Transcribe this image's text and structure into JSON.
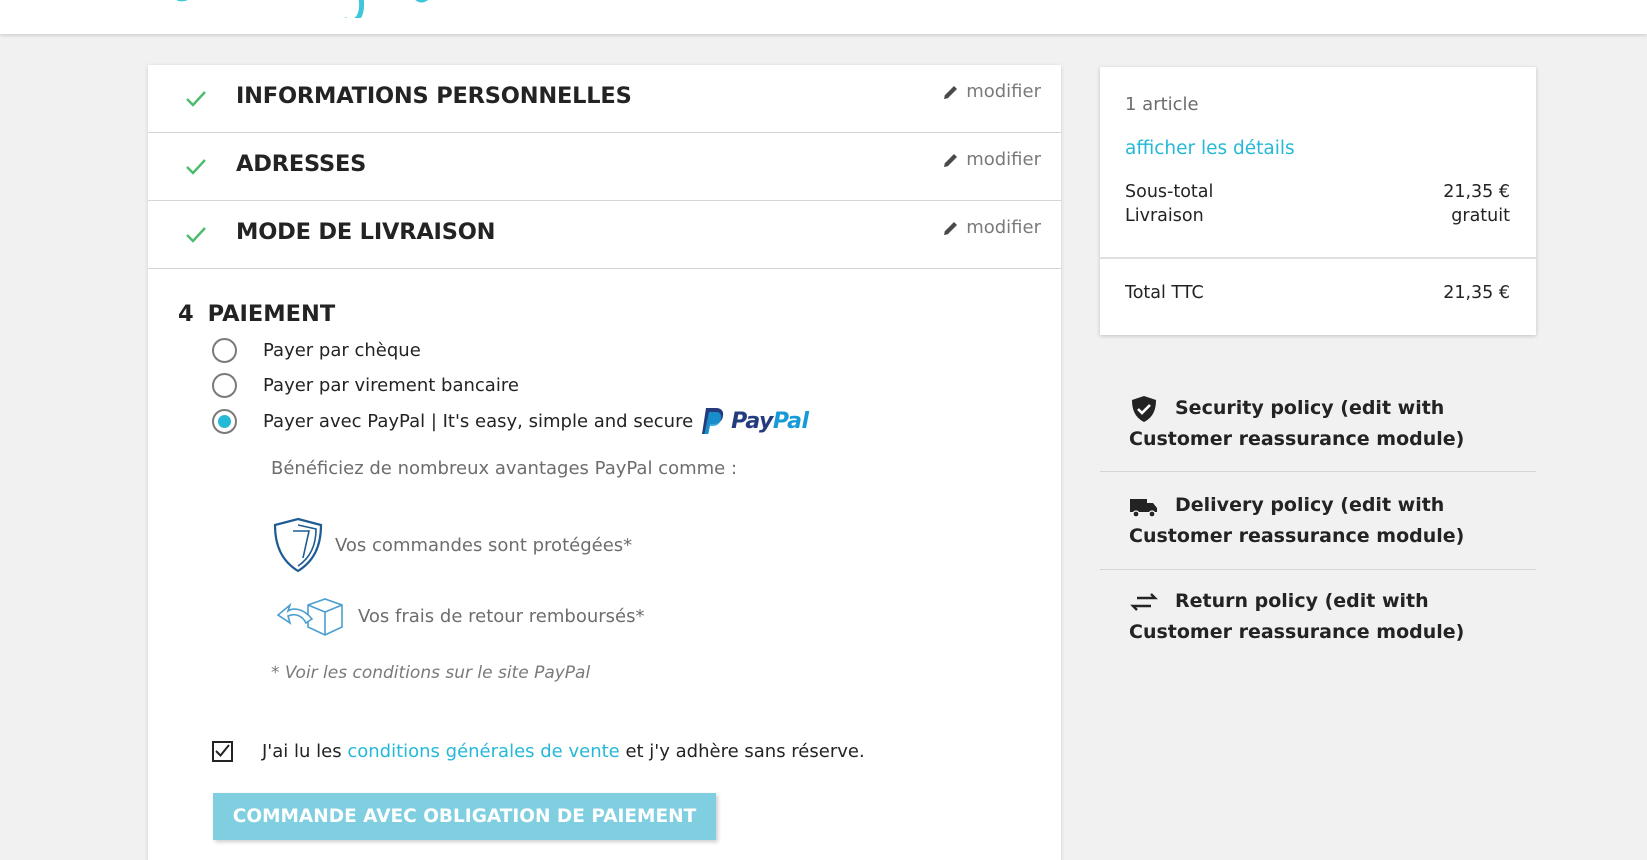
{
  "colors": {
    "accent": "#24b9d7",
    "check": "#4cbb6c",
    "button_bg": "#7fcfe0"
  },
  "steps": [
    {
      "title": "INFORMATIONS PERSONNELLES",
      "edit_label": "modifier"
    },
    {
      "title": "ADRESSES",
      "edit_label": "modifier"
    },
    {
      "title": "MODE DE LIVRAISON",
      "edit_label": "modifier"
    }
  ],
  "payment": {
    "number": "4",
    "title": "PAIEMENT",
    "options": [
      {
        "label": "Payer par chèque",
        "selected": false
      },
      {
        "label": "Payer par virement bancaire",
        "selected": false
      },
      {
        "label": "Payer avec PayPal | It's easy, simple and secure",
        "selected": true
      }
    ],
    "paypal_logo": {
      "pay": "Pay",
      "pal": "Pal"
    },
    "benefits_intro": "Bénéficiez de nombreux avantages PayPal comme :",
    "benefit_protected": "Vos commandes sont protégées*",
    "benefit_refund": "Vos frais de retour remboursés*",
    "conditions_note": "* Voir les conditions sur le site PayPal"
  },
  "terms": {
    "checked": true,
    "prefix": "J'ai lu les ",
    "link": "conditions générales de vente",
    "suffix": " et j'y adhère sans réserve."
  },
  "order_button": "COMMANDE AVEC OBLIGATION DE PAIEMENT",
  "summary": {
    "count": "1 article",
    "details_link": "afficher les détails",
    "subtotal_label": "Sous-total",
    "subtotal_value": "21,35 €",
    "shipping_label": "Livraison",
    "shipping_value": "gratuit",
    "total_label": "Total TTC",
    "total_value": "21,35 €"
  },
  "reassurance": {
    "security": "Security policy (edit with Customer reassurance module)",
    "delivery": "Delivery policy (edit with Customer reassurance module)",
    "return": "Return policy (edit with Customer reassurance module)"
  }
}
